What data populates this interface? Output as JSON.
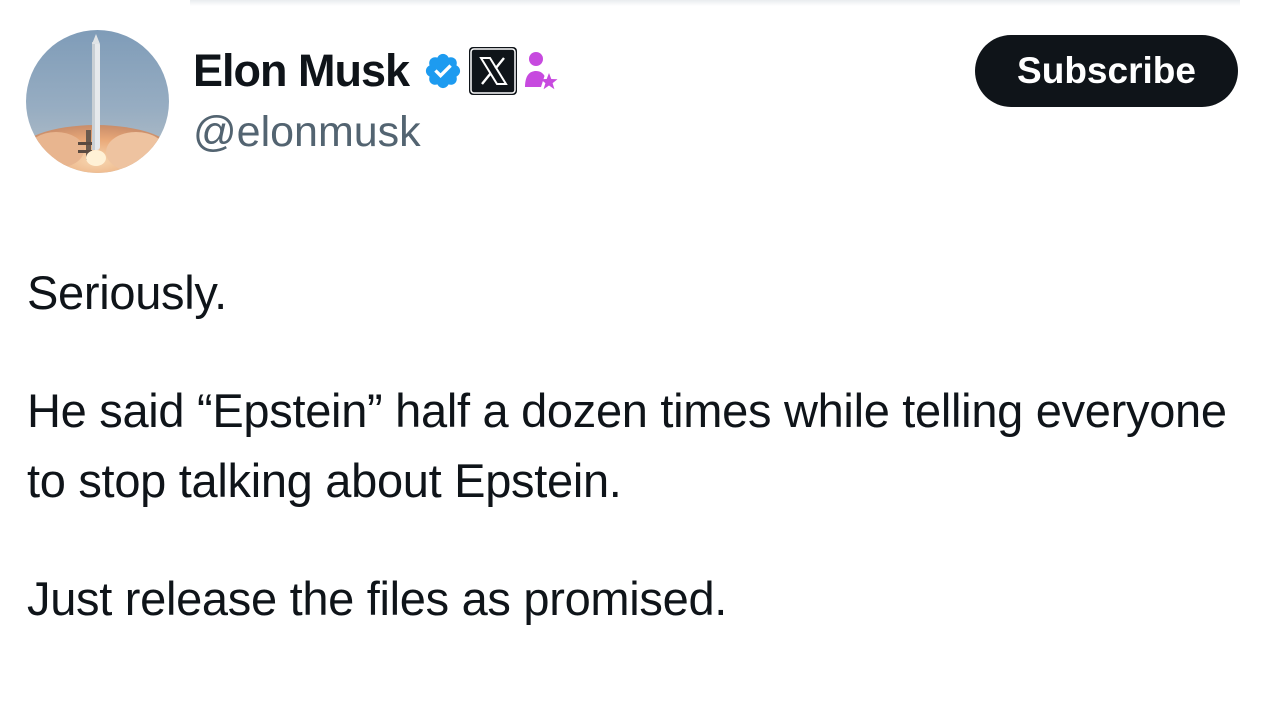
{
  "author": {
    "display_name": "Elon Musk",
    "handle": "@elonmusk",
    "badges": {
      "verified": "verified-check-icon",
      "affiliate": "x-logo-icon",
      "subscriber": "person-star-icon"
    },
    "colors": {
      "verified": "#1d9bf0",
      "subscriber": "#c74adf"
    }
  },
  "subscribe": {
    "label": "Subscribe"
  },
  "tweet": {
    "paragraphs": [
      "Seriously.",
      "He said “Epstein” half a dozen times while telling everyone to stop talking about Epstein.",
      "Just release the files as promised."
    ]
  }
}
